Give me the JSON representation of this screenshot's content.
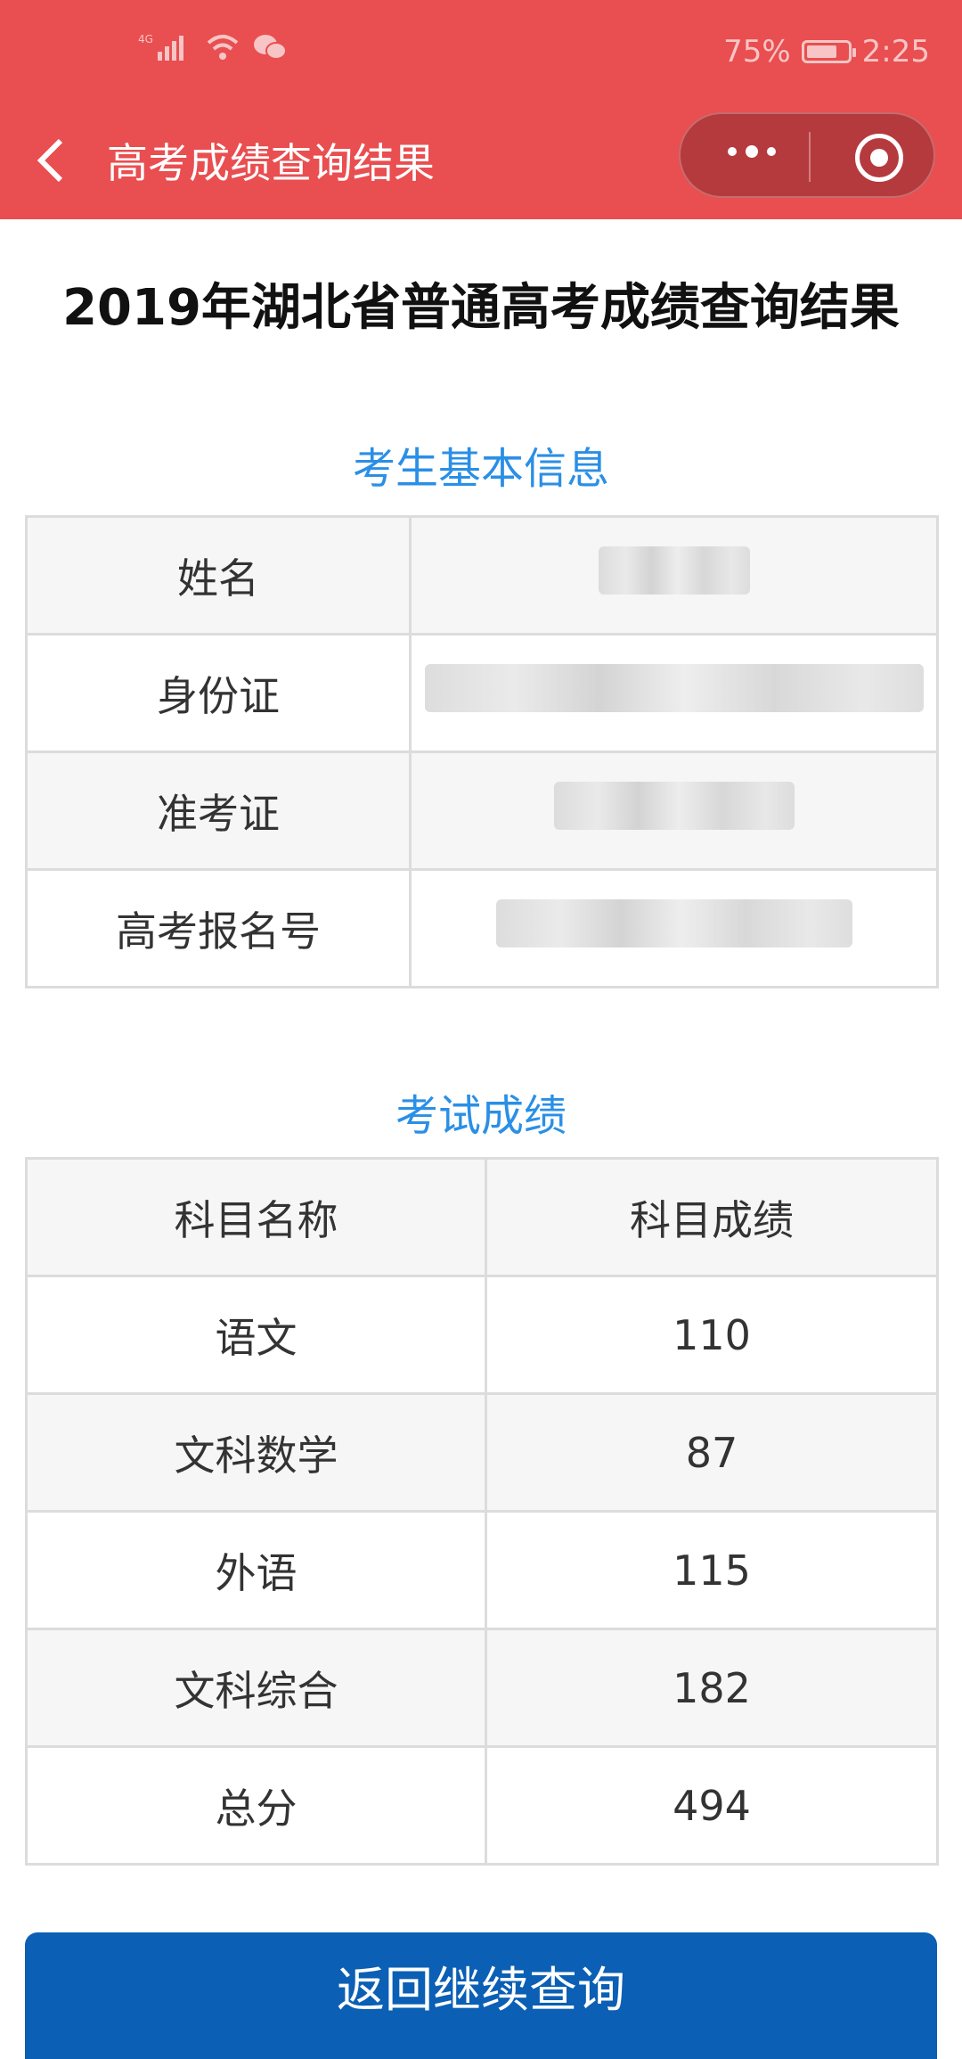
{
  "status_bar": {
    "network_label": "4G",
    "battery_text": "75%",
    "battery_level": 0.75,
    "time": "2:25"
  },
  "nav": {
    "back_icon": "chevron-left-icon",
    "title": "高考成绩查询结果",
    "more_icon": "more-dots-icon",
    "close_icon": "target-close-icon"
  },
  "page": {
    "title": "2019年湖北省普通高考成绩查询结果",
    "accent_color": "#2a8fe6",
    "header_color": "#e94e50",
    "button_color": "#0b5fb4"
  },
  "info_section": {
    "title": "考生基本信息",
    "rows": [
      {
        "label": "姓名"
      },
      {
        "label": "身份证"
      },
      {
        "label": "准考证"
      },
      {
        "label": "高考报名号"
      }
    ]
  },
  "score_section": {
    "title": "考试成绩",
    "headers": [
      "科目名称",
      "科目成绩"
    ],
    "rows": [
      {
        "subject": "语文",
        "score": "110"
      },
      {
        "subject": "文科数学",
        "score": "87"
      },
      {
        "subject": "外语",
        "score": "115"
      },
      {
        "subject": "文科综合",
        "score": "182"
      },
      {
        "subject": "总分",
        "score": "494"
      }
    ]
  },
  "actions": {
    "back_query_label": "返回继续查询"
  }
}
